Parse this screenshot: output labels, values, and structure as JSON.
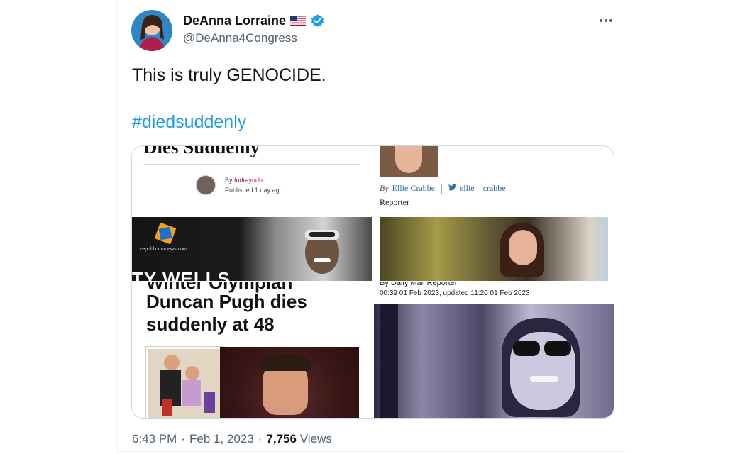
{
  "author": {
    "display_name": "DeAnna Lorraine",
    "handle": "@DeAnna4Congress"
  },
  "tweet": {
    "text": "This is truly GENOCIDE.",
    "hashtag": "#diedsuddenly",
    "time": "6:43 PM",
    "date": "Feb 1, 2023",
    "views_count": "7,756",
    "views_label": "Views"
  },
  "media": {
    "tl": {
      "headline_fragment": "Dies Suddenly",
      "by": "By",
      "author": "Indrayudh",
      "published": "Published 1 day ago",
      "site": "republicmonews.com",
      "banner_text": "TY WELLS"
    },
    "tr": {
      "by": "By",
      "author": "Ellie Crabbe",
      "twitter": "ellie__crabbe",
      "role": "Reporter"
    },
    "bl": {
      "headline_top": "Winter Olympian",
      "headline_1": "Duncan Pugh dies",
      "headline_2": "suddenly at 48"
    },
    "br": {
      "byline": "By Daily Mail Reporter",
      "timestamp": "00:39 01 Feb 2023, updated 11:20 01 Feb 2023"
    }
  },
  "colors": {
    "link": "#1d9bf0",
    "text": "#0f1419",
    "secondary": "#536471",
    "verified": "#1d9bf0"
  }
}
